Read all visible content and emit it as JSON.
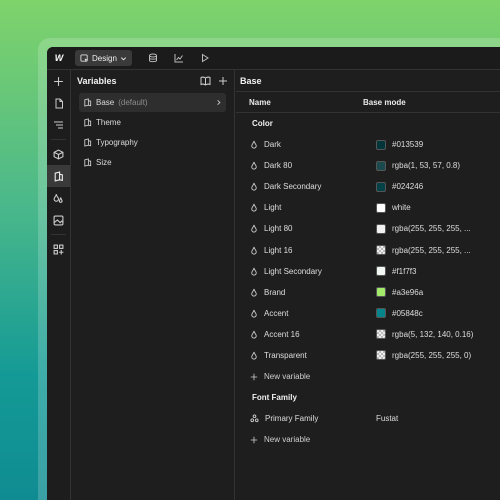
{
  "toolbar": {
    "logo": "W",
    "mode_label": "Design",
    "icons": [
      "database-icon",
      "analytics-icon",
      "play-icon"
    ]
  },
  "rail": {
    "icons": [
      "add-icon",
      "page-icon",
      "navigator-icon",
      "components-icon",
      "variables-icon",
      "styles-icon",
      "assets-icon",
      "apps-icon"
    ]
  },
  "variables_panel": {
    "title": "Variables",
    "collections": [
      {
        "name": "Base",
        "suffix": "(default)",
        "selected": true
      },
      {
        "name": "Theme",
        "suffix": ""
      },
      {
        "name": "Typography",
        "suffix": ""
      },
      {
        "name": "Size",
        "suffix": ""
      }
    ]
  },
  "main": {
    "title": "Base",
    "columns": {
      "name": "Name",
      "mode": "Base mode"
    },
    "groups": [
      {
        "title": "Color",
        "rows": [
          {
            "name": "Dark",
            "value": "#013539",
            "swatch": "#013539"
          },
          {
            "name": "Dark 80",
            "value": "rgba(1, 53, 57, 0.8)",
            "swatch": "#1a4a4d"
          },
          {
            "name": "Dark Secondary",
            "value": "#024246",
            "swatch": "#024246"
          },
          {
            "name": "Light",
            "value": "white",
            "swatch": "#ffffff"
          },
          {
            "name": "Light 80",
            "value": "rgba(255, 255, 255, ...",
            "swatch": "#f2f2f2"
          },
          {
            "name": "Light 16",
            "value": "rgba(255, 255, 255, ...",
            "swatch": "checker"
          },
          {
            "name": "Light Secondary",
            "value": "#f1f7f3",
            "swatch": "#f1f7f3"
          },
          {
            "name": "Brand",
            "value": "#a3e96a",
            "swatch": "#a3e96a"
          },
          {
            "name": "Accent",
            "value": "#05848c",
            "swatch": "#05848c"
          },
          {
            "name": "Accent 16",
            "value": "rgba(5, 132, 140, 0.16)",
            "swatch": "checker"
          },
          {
            "name": "Transparent",
            "value": "rgba(255, 255, 255, 0)",
            "swatch": "checker"
          }
        ],
        "new_label": "New variable"
      },
      {
        "title": "Font Family",
        "rows": [
          {
            "name": "Primary Family",
            "value": "Fustat",
            "swatch": "none"
          }
        ],
        "new_label": "New variable"
      }
    ]
  }
}
